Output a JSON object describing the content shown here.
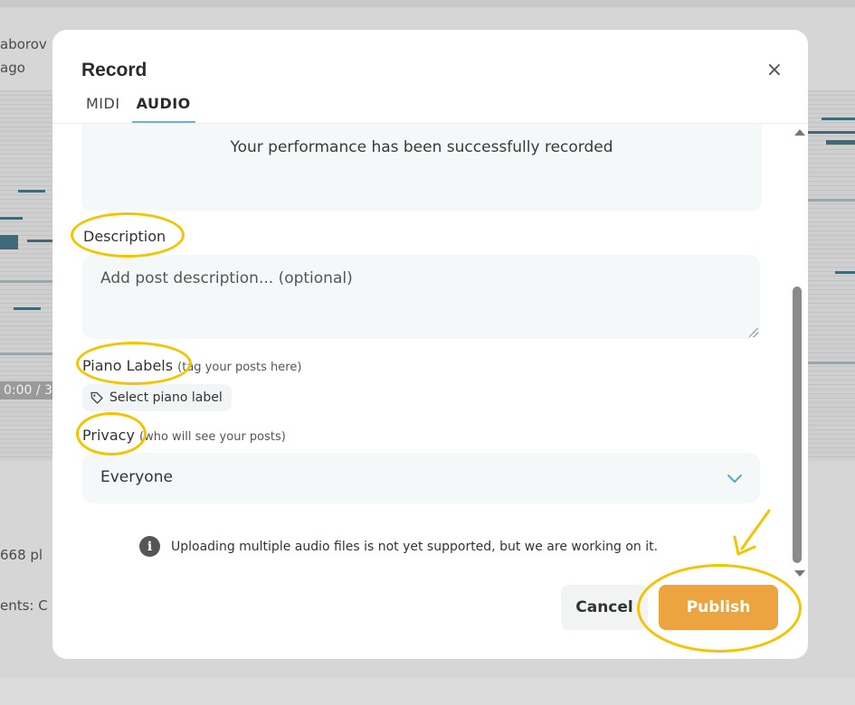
{
  "background": {
    "user_name_fragment": "aborov",
    "time_ago_fragment": "ago",
    "time_display_fragment": "0:00 / 3",
    "plays_fragment": "668 pl",
    "comments_fragment": "ents: C"
  },
  "modal": {
    "title": "Record",
    "close_glyph": "×",
    "tabs": [
      {
        "label": "MIDI",
        "active": false
      },
      {
        "label": "AUDIO",
        "active": true
      }
    ],
    "success_message": "Your performance has been successfully recorded",
    "description": {
      "label": "Description",
      "placeholder": "Add post description... (optional)",
      "value": ""
    },
    "piano_labels": {
      "label": "Piano Labels",
      "hint": "(tag your posts here)",
      "chip_label": "Select piano label",
      "chip_icon": "tag-icon"
    },
    "privacy": {
      "label": "Privacy",
      "hint": "(who will see your posts)",
      "selected": "Everyone",
      "icon": "chevron-down-icon"
    },
    "info": {
      "icon": "info-icon",
      "glyph": "i",
      "text": "Uploading multiple audio files is not yet supported, but we are working on it."
    },
    "buttons": {
      "cancel": "Cancel",
      "publish": "Publish"
    }
  },
  "colors": {
    "accent_tab_underline": "#6ab7c9",
    "publish_button": "#eba43f",
    "chevron": "#5aa9bf",
    "annotation": "#f5c400",
    "field_background": "#f4f8f8"
  }
}
